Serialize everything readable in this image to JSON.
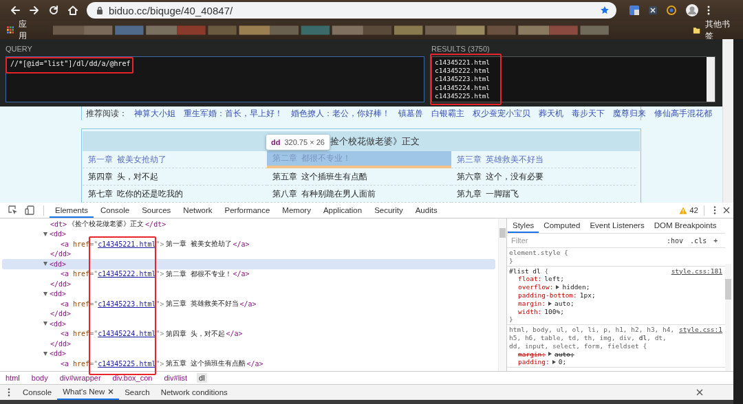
{
  "browser": {
    "url": "biduo.cc/biquge/40_40847/",
    "apps_label": "应用",
    "other_bookmarks": "其他书签"
  },
  "xpath_helper": {
    "query_label": "QUERY",
    "query": "//*[@id=\"list\"]/dl/dd/a/@href",
    "results_label": "RESULTS (3750)",
    "results": [
      "c14345221.html",
      "c14345222.html",
      "c14345223.html",
      "c14345224.html",
      "c14345225.html"
    ]
  },
  "page": {
    "recommend_label": "推荐阅读：",
    "recommend_links": [
      "神算大小姐",
      "重生军婚：首长，早上好！",
      "婚色撩人：老公，你好棒！",
      "镇墓兽",
      "白银霸主",
      "权少蚕宠小宝贝",
      "葬天机",
      "毒步天下",
      "魔尊归来",
      "修仙高手混花都"
    ],
    "chapter_list": {
      "title": "捡个校花做老婆》正文",
      "chapters": [
        {
          "title": "第一章  被美女抢劫了",
          "visited": true,
          "selected": false
        },
        {
          "title": "第二章  都很不专业！",
          "visited": true,
          "selected": true
        },
        {
          "title": "第三章  英雄救美不好当",
          "visited": true,
          "selected": false
        },
        {
          "title": "第四章  头，对不起",
          "visited": false,
          "selected": false
        },
        {
          "title": "第五章  这个插班生有点酷",
          "visited": false,
          "selected": false
        },
        {
          "title": "第六章  这个，没有必要",
          "visited": false,
          "selected": false
        },
        {
          "title": "第七章  吃你的还是吃我的",
          "visited": false,
          "selected": false
        },
        {
          "title": "第八章  有种别跪在男人面前",
          "visited": false,
          "selected": false
        },
        {
          "title": "第九章  一脚踹飞",
          "visited": false,
          "selected": false
        }
      ]
    },
    "inspect_tooltip": {
      "tag": "dd",
      "size": "320.75 × 26"
    }
  },
  "devtools": {
    "tabs": [
      {
        "label": "Elements",
        "selected": true
      },
      {
        "label": "Console",
        "selected": false
      },
      {
        "label": "Sources",
        "selected": false
      },
      {
        "label": "Network",
        "selected": false
      },
      {
        "label": "Performance",
        "selected": false
      },
      {
        "label": "Memory",
        "selected": false
      },
      {
        "label": "Application",
        "selected": false
      },
      {
        "label": "Security",
        "selected": false
      },
      {
        "label": "Audits",
        "selected": false
      }
    ],
    "warnings": "42",
    "dom_tree": [
      {
        "segments": [
          {
            "kind": "tag",
            "text": "<dt>"
          },
          {
            "kind": "text",
            "text": "《捡个校花做老婆》正文"
          },
          {
            "kind": "tag",
            "text": "</dt>"
          }
        ]
      },
      {
        "open_tag": "<dd>",
        "close_tag": "</dd>",
        "expanded": true,
        "selected": false,
        "children": [
          {
            "segments": [
              {
                "kind": "tag",
                "text": "<a"
              },
              {
                "kind": "attr",
                "text": "href"
              },
              {
                "kind": "punct",
                "text": "=\""
              },
              {
                "kind": "link",
                "text": "c14345221.html"
              },
              {
                "kind": "punct",
                "text": "\">"
              },
              {
                "kind": "text",
                "text": "第一章 被美女抢劫了"
              },
              {
                "kind": "tag",
                "text": "</a>"
              }
            ]
          }
        ]
      },
      {
        "open_tag": "<dd>",
        "close_tag": "</dd>",
        "expanded": true,
        "selected": true,
        "children": [
          {
            "segments": [
              {
                "kind": "tag",
                "text": "<a"
              },
              {
                "kind": "attr",
                "text": "href"
              },
              {
                "kind": "punct",
                "text": "=\""
              },
              {
                "kind": "link",
                "text": "c14345222.html"
              },
              {
                "kind": "punct",
                "text": "\">"
              },
              {
                "kind": "text",
                "text": "第二章 都很不专业！"
              },
              {
                "kind": "tag",
                "text": "</a>"
              }
            ]
          }
        ]
      },
      {
        "open_tag": "<dd>",
        "close_tag": "</dd>",
        "expanded": true,
        "selected": false,
        "children": [
          {
            "segments": [
              {
                "kind": "tag",
                "text": "<a"
              },
              {
                "kind": "attr",
                "text": "href"
              },
              {
                "kind": "punct",
                "text": "=\""
              },
              {
                "kind": "link",
                "text": "c14345223.html"
              },
              {
                "kind": "punct",
                "text": "\">"
              },
              {
                "kind": "text",
                "text": "第三章 英雄救美不好当"
              },
              {
                "kind": "tag",
                "text": "</a>"
              }
            ]
          }
        ]
      },
      {
        "open_tag": "<dd>",
        "close_tag": "</dd>",
        "expanded": true,
        "selected": false,
        "children": [
          {
            "segments": [
              {
                "kind": "tag",
                "text": "<a"
              },
              {
                "kind": "attr",
                "text": "href"
              },
              {
                "kind": "punct",
                "text": "=\""
              },
              {
                "kind": "link",
                "text": "c14345224.html"
              },
              {
                "kind": "punct",
                "text": "\">"
              },
              {
                "kind": "text",
                "text": "第四章 头，对不起"
              },
              {
                "kind": "tag",
                "text": "</a>"
              }
            ]
          }
        ]
      },
      {
        "open_tag": "<dd>",
        "expanded": true,
        "selected": false,
        "children": [
          {
            "segments": [
              {
                "kind": "tag",
                "text": "<a"
              },
              {
                "kind": "attr",
                "text": "href"
              },
              {
                "kind": "punct",
                "text": "=\""
              },
              {
                "kind": "link",
                "text": "c14345225.html"
              },
              {
                "kind": "punct",
                "text": "\">"
              },
              {
                "kind": "text",
                "text": "第五章 这个插班生有点酷"
              },
              {
                "kind": "tag",
                "text": "</a>"
              }
            ]
          }
        ]
      }
    ],
    "breadcrumbs": [
      {
        "text": "html",
        "selected": false
      },
      {
        "text": "body",
        "selected": false
      },
      {
        "text": "div#wrapper",
        "selected": false
      },
      {
        "text": "div.box_con",
        "selected": false
      },
      {
        "text": "div#list",
        "selected": false
      },
      {
        "text": "dl",
        "selected": true
      }
    ],
    "styles": {
      "tabs": [
        {
          "label": "Styles",
          "selected": true
        },
        {
          "label": "Computed",
          "selected": false
        },
        {
          "label": "Event Listeners",
          "selected": false
        },
        {
          "label": "DOM Breakpoints",
          "selected": false
        }
      ],
      "filter": {
        "placeholder": "Filter"
      },
      "toggles": [
        ":hov",
        ".cls",
        "+"
      ],
      "rules": [
        {
          "selector": "element.style {",
          "close": "}"
        },
        {
          "selector": "**#list dl** {",
          "source": "style.css:181",
          "close": "}",
          "declarations": [
            {
              "property": "float:",
              "value": "left;",
              "expandable": false,
              "overridden": false
            },
            {
              "property": "overflow:",
              "value": "hidden;",
              "expandable": true,
              "overridden": false
            },
            {
              "property": "padding-bottom:",
              "value": "1px;",
              "expandable": false,
              "overridden": false
            },
            {
              "property": "margin:",
              "value": "auto;",
              "expandable": true,
              "overridden": false
            },
            {
              "property": "width:",
              "value": "100%;",
              "expandable": false,
              "overridden": false
            }
          ]
        },
        {
          "selector": "html, body, ul, ol, li, p, h1, h2, h3, h4, h5, h6, table, td, th, img, div, **dl**, dt, dd, input, select, form, fieldset {",
          "source": "style.css:1",
          "declarations": [
            {
              "property": "margin:",
              "value": "auto;",
              "expandable": true,
              "overridden": true
            },
            {
              "property": "padding:",
              "value": "0;",
              "expandable": true,
              "overridden": false
            }
          ]
        }
      ]
    },
    "drawer_tabs": [
      {
        "label": "Console",
        "selected": false,
        "closable": false
      },
      {
        "label": "What's New",
        "selected": true,
        "closable": true
      },
      {
        "label": "Search",
        "selected": false,
        "closable": false
      },
      {
        "label": "Network conditions",
        "selected": false,
        "closable": false
      }
    ]
  }
}
